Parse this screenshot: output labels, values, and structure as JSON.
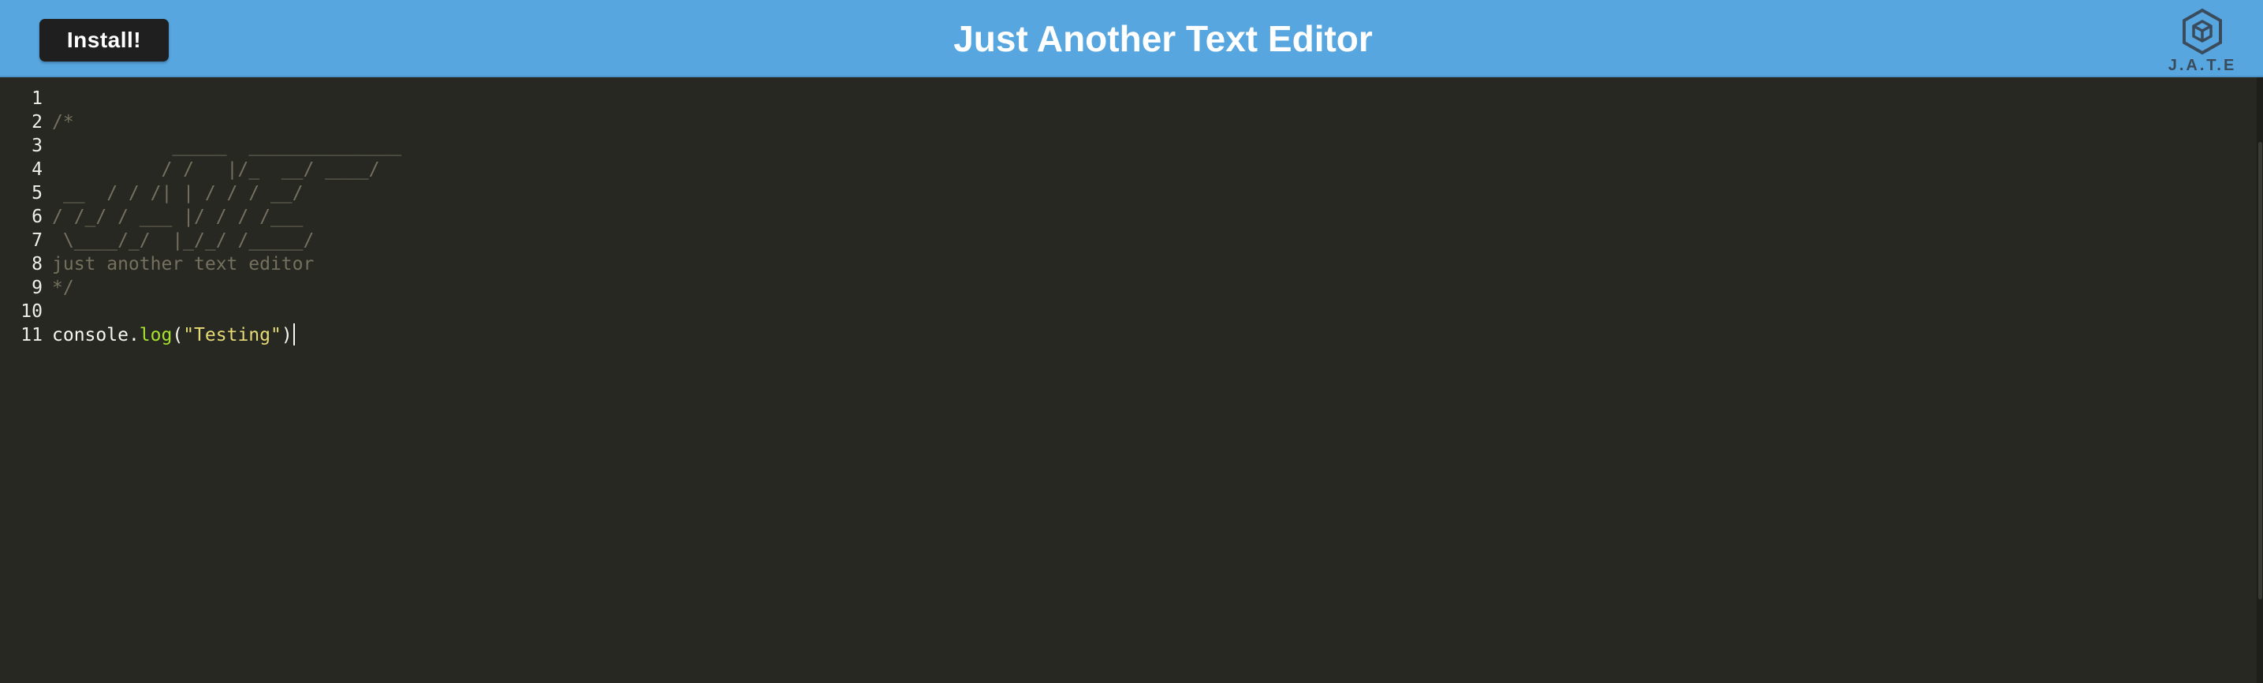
{
  "header": {
    "install_label": "Install!",
    "title": "Just Another Text Editor",
    "logo_text": "J.A.T.E",
    "logo_icon": "hexagon-cube-icon",
    "background_color": "#57a6e0"
  },
  "editor": {
    "theme_background": "#272822",
    "lines": [
      {
        "num": "1",
        "text": ""
      },
      {
        "num": "2",
        "text": "/*"
      },
      {
        "num": "3",
        "text": "           _____  ______________"
      },
      {
        "num": "4",
        "text": "          / /   |/_  __/ ____/"
      },
      {
        "num": "5",
        "text": " __  / / /| | / / / __/"
      },
      {
        "num": "6",
        "text": "/ /_/ / ___ |/ / / /___"
      },
      {
        "num": "7",
        "text": " \\____/_/  |_/_/ /_____/"
      },
      {
        "num": "8",
        "text": "just another text editor"
      },
      {
        "num": "9",
        "text": "*/"
      },
      {
        "num": "10",
        "text": ""
      }
    ],
    "code_line": {
      "num": "11",
      "object": "console",
      "dot": ".",
      "method": "log",
      "open_paren": "(",
      "string": "\"Testing\"",
      "close_paren": ")"
    }
  }
}
